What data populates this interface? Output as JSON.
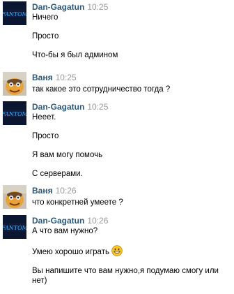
{
  "conversation": {
    "groups": [
      {
        "author": "Dan-Gagatun",
        "time": "10:25",
        "avatar_icon": "fantom-logo-avatar",
        "avatar_text": "FANTOM",
        "messages": [
          "Ничего",
          "Просто",
          "Что-бы я был админом"
        ]
      },
      {
        "author": "Ваня",
        "time": "10:25",
        "avatar_icon": "cartoon-face-avatar",
        "messages": [
          "так какое это сотрудничество тогда ?"
        ]
      },
      {
        "author": "Dan-Gagatun",
        "time": "10:25",
        "avatar_icon": "fantom-logo-avatar",
        "avatar_text": "FANTOM",
        "messages": [
          "Нееет.",
          "Просто",
          "Я вам могу помочь",
          "С серверами."
        ]
      },
      {
        "author": "Ваня",
        "time": "10:26",
        "avatar_icon": "cartoon-face-avatar",
        "messages": [
          "что конкретней умеете ?"
        ]
      },
      {
        "author": "Dan-Gagatun",
        "time": "10:26",
        "avatar_icon": "fantom-logo-avatar",
        "avatar_text": "FANTOM",
        "messages": [
          "А что вам нужно?",
          "Умею хорошо играть",
          "Вы напишите что вам нужно,я подумаю смогу или нет)"
        ],
        "emoji_icon": "grinning-smiley-icon"
      }
    ]
  },
  "colors": {
    "author": "#2b587a",
    "time": "#999999",
    "text": "#000000",
    "background": "#ffffff"
  }
}
